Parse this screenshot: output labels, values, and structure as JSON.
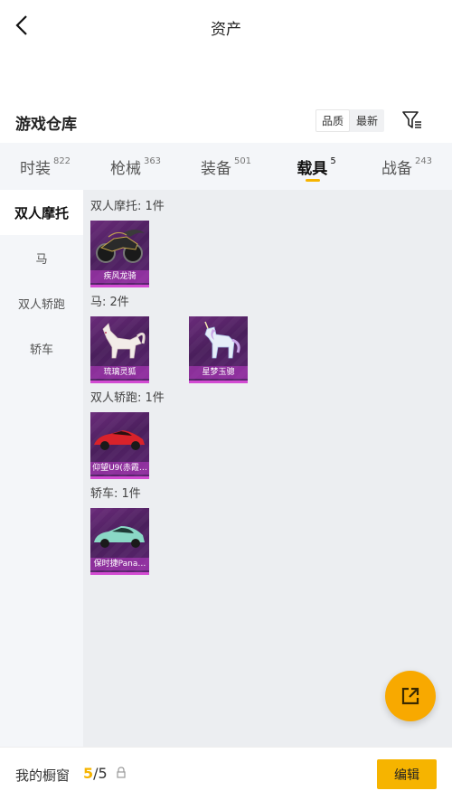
{
  "header": {
    "title": "资产",
    "back_icon": "chevron-left-icon"
  },
  "warehouse": {
    "title": "游戏仓库",
    "sort_options": [
      {
        "label": "品质",
        "active": true
      },
      {
        "label": "最新",
        "active": false
      }
    ],
    "filter_icon": "filter-list-icon"
  },
  "tabs": [
    {
      "label": "时装",
      "count": "822",
      "active": false
    },
    {
      "label": "枪械",
      "count": "363",
      "active": false
    },
    {
      "label": "装备",
      "count": "501",
      "active": false
    },
    {
      "label": "载具",
      "count": "5",
      "active": true
    },
    {
      "label": "战备",
      "count": "243",
      "active": false
    }
  ],
  "sidebar": {
    "items": [
      {
        "label": "双人摩托",
        "active": true
      },
      {
        "label": "马",
        "active": false
      },
      {
        "label": "双人轿跑",
        "active": false
      },
      {
        "label": "轿车",
        "active": false
      }
    ]
  },
  "groups": [
    {
      "label": "双人摩托: 1件",
      "items": [
        {
          "name": "疾风龙骑",
          "icon": "motorcycle-icon"
        }
      ]
    },
    {
      "label": "马: 2件",
      "items": [
        {
          "name": "琉璃灵狐",
          "icon": "crystal-fox-icon"
        },
        {
          "name": "星梦玉骢",
          "icon": "unicorn-icon"
        }
      ]
    },
    {
      "label": "双人轿跑: 1件",
      "items": [
        {
          "name": "仰望U9(赤霞…",
          "icon": "red-sports-car-icon"
        }
      ]
    },
    {
      "label": "轿车: 1件",
      "items": [
        {
          "name": "保时捷Pana…",
          "icon": "mint-sedan-icon"
        }
      ]
    }
  ],
  "fab": {
    "icon": "share-external-icon"
  },
  "bottom_bar": {
    "label": "我的橱窗",
    "count_current": "5",
    "count_separator": "/",
    "count_total": "5",
    "lock_icon": "lock-icon",
    "edit_label": "编辑"
  },
  "colors": {
    "accent": "#f6b400",
    "card_purple": "#5b2570",
    "card_border": "#d24bd2"
  }
}
